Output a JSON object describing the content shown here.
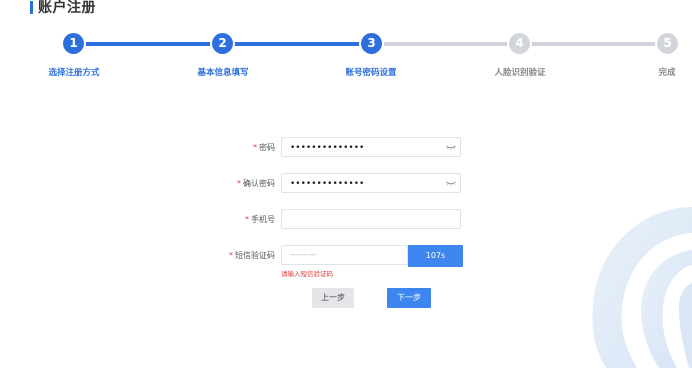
{
  "header": {
    "title": "账户注册"
  },
  "steps": [
    {
      "number": "1",
      "label": "选择注册方式"
    },
    {
      "number": "2",
      "label": "基本信息填写"
    },
    {
      "number": "3",
      "label": "账号密码设置"
    },
    {
      "number": "4",
      "label": "人脸识别验证"
    },
    {
      "number": "5",
      "label": "完成"
    }
  ],
  "form": {
    "required_mark": "*",
    "password": {
      "label": "密码",
      "value": "••••••••••••••"
    },
    "confirm_password": {
      "label": "确认密码",
      "value": "••••••••••••••"
    },
    "phone": {
      "label": "手机号",
      "value": ""
    },
    "sms_code": {
      "label": "短信验证码",
      "value": "",
      "placeholder": "———",
      "button_label": "107s",
      "error": "请输入短信验证码"
    }
  },
  "actions": {
    "prev_label": "上一步",
    "next_label": "下一步"
  },
  "colors": {
    "accent": "#2d6fdc",
    "button": "#3d86f0",
    "inactive": "#d2d5da",
    "error": "#e53935"
  }
}
